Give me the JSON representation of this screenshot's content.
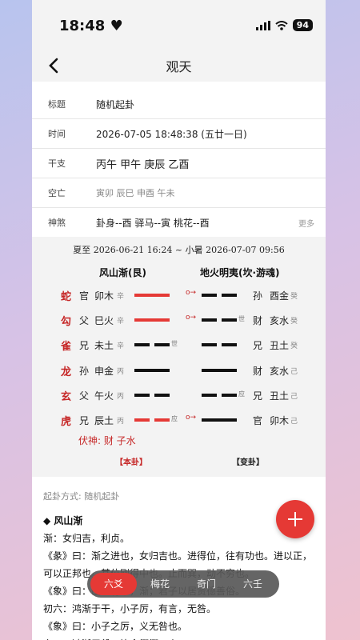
{
  "status_bar": {
    "time": "18:48",
    "heart": "♥",
    "signal_icon": "signal-icon",
    "wifi_icon": "wifi-icon",
    "battery": "94"
  },
  "nav": {
    "title": "观天",
    "back_icon": "back-chevron-icon"
  },
  "info": {
    "title_label": "标题",
    "title_value": "随机起卦",
    "time_label": "时间",
    "time_value": "2026-07-05 18:48:38 (五廿一日)",
    "ganzhi_label": "干支",
    "ganzhi_value": "丙午 甲午 庚辰 乙酉",
    "kongwang_label": "空亡",
    "kongwang_value": "寅卯 辰巳 申酉 午未",
    "shensha_label": "神煞",
    "shensha_value": "卦身--酉   驿马--寅   桃花--酉",
    "more": "更多"
  },
  "chart": {
    "jieqi": "夏至 2026-06-21 16:24 ~ 小暑 2026-07-07 09:56",
    "ben_gua_name": "风山渐(艮)",
    "bian_gua_name": "地火明夷(坎·游魂)",
    "lines": [
      {
        "god": "蛇",
        "kin": "官",
        "branch": "卯木",
        "wx": "辛",
        "yang": true,
        "moving": true,
        "mark": "",
        "arrow": "o→",
        "r_yang": false,
        "r_mark": "",
        "r_kin": "孙",
        "r_branch": "酉金",
        "r_wx": "癸"
      },
      {
        "god": "勾",
        "kin": "父",
        "branch": "巳火",
        "wx": "辛",
        "yang": true,
        "moving": true,
        "mark": "",
        "arrow": "o→",
        "r_yang": false,
        "r_mark": "世",
        "r_kin": "财",
        "r_branch": "亥水",
        "r_wx": "癸"
      },
      {
        "god": "雀",
        "kin": "兄",
        "branch": "未土",
        "wx": "辛",
        "yang": false,
        "moving": false,
        "mark": "世",
        "arrow": "",
        "r_yang": false,
        "r_mark": "",
        "r_kin": "兄",
        "r_branch": "丑土",
        "r_wx": "癸"
      },
      {
        "god": "龙",
        "kin": "孙",
        "branch": "申金",
        "wx": "丙",
        "yang": true,
        "moving": false,
        "mark": "",
        "arrow": "",
        "r_yang": true,
        "r_mark": "",
        "r_kin": "财",
        "r_branch": "亥水",
        "r_wx": "己"
      },
      {
        "god": "玄",
        "kin": "父",
        "branch": "午火",
        "wx": "丙",
        "yang": false,
        "moving": false,
        "mark": "",
        "arrow": "",
        "r_yang": false,
        "r_mark": "应",
        "r_kin": "兄",
        "r_branch": "丑土",
        "r_wx": "己"
      },
      {
        "god": "虎",
        "kin": "兄",
        "branch": "辰土",
        "wx": "丙",
        "yang": false,
        "moving": true,
        "mark": "应",
        "arrow": "o→",
        "r_yang": true,
        "r_mark": "",
        "r_kin": "官",
        "r_branch": "卯木",
        "r_wx": "己"
      }
    ],
    "fushen": "伏神: 财 子水",
    "ben_tag": "【本卦】",
    "bian_tag": "【变卦】"
  },
  "method": "起卦方式: 随机起卦",
  "text_lines": [
    "◆ 风山渐",
    "渐：女归吉，利贞。",
    "《彖》曰：渐之进也，女归吉也。进得位，往有功也。进以正，",
    "可以正邦也。其位刚得中也。止而巽，动不穷也。",
    "《象》曰：山上有木，渐；君子以居贤德善俗。",
    "初六：鸿渐于干，小子厉，有言，无咎。",
    "    《象》曰：小子之厉，义无咎也。",
    "六二：鸿渐于磐，饮食衎衎，吉。"
  ],
  "tabs": [
    {
      "label": "六爻",
      "active": true
    },
    {
      "label": "梅花",
      "active": false
    },
    {
      "label": "奇门",
      "active": false
    },
    {
      "label": "六壬",
      "active": false
    }
  ],
  "colors": {
    "accent": "#e53935",
    "god_text": "#c62828",
    "yao_black": "#111111"
  }
}
